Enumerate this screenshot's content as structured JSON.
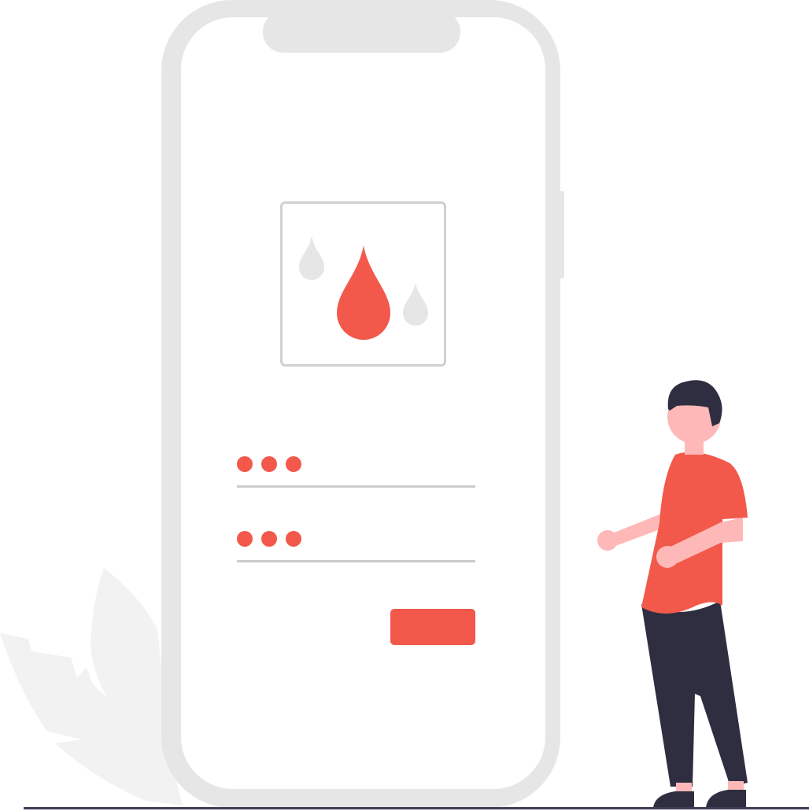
{
  "scene": "phone-login-illustration",
  "colors": {
    "accent": "#f2594b",
    "phone_frame": "#e6e6e6",
    "screen": "#ffffff",
    "field_underline": "#cccccc",
    "droplet_gray": "#e6e6e6",
    "plant": "#f2f2f2",
    "skin": "#ffb8b8",
    "hair": "#2f2e41",
    "pants": "#2f2e41",
    "ground": "#3f3d56"
  },
  "icons": {
    "droplets": "blood-drop-icon",
    "masked_input": "password-dots"
  },
  "form": {
    "field_1": {
      "masked_dots": 3
    },
    "field_2": {
      "masked_dots": 3
    },
    "submit_button": {
      "label": ""
    }
  }
}
